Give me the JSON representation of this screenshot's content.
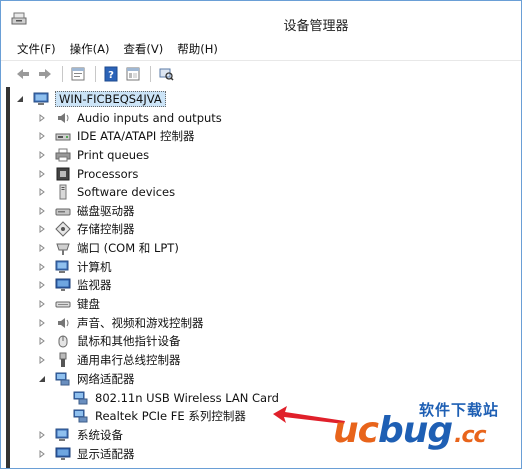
{
  "window": {
    "title": "设备管理器"
  },
  "menu": [
    {
      "label": "文件(F)"
    },
    {
      "label": "操作(A)"
    },
    {
      "label": "查看(V)"
    },
    {
      "label": "帮助(H)"
    }
  ],
  "toolbar": {
    "buttons": [
      {
        "icon": "back-arrow-icon"
      },
      {
        "icon": "forward-arrow-icon"
      },
      {
        "icon": "properties-icon"
      },
      {
        "icon": "help-icon"
      },
      {
        "icon": "console-view-icon"
      },
      {
        "icon": "scan-hardware-icon"
      }
    ]
  },
  "tree": {
    "root": {
      "label": "WIN-FICBEQS4JVA",
      "expanded": true
    },
    "items": [
      {
        "label": "Audio inputs and outputs",
        "icon": "speaker-icon",
        "expanded": false
      },
      {
        "label": "IDE ATA/ATAPI 控制器",
        "icon": "ide-controller-icon",
        "expanded": false
      },
      {
        "label": "Print queues",
        "icon": "printer-icon",
        "expanded": false
      },
      {
        "label": "Processors",
        "icon": "processor-icon",
        "expanded": false
      },
      {
        "label": "Software devices",
        "icon": "software-device-icon",
        "expanded": false
      },
      {
        "label": "磁盘驱动器",
        "icon": "disk-drive-icon",
        "expanded": false
      },
      {
        "label": "存储控制器",
        "icon": "storage-controller-icon",
        "expanded": false
      },
      {
        "label": "端口 (COM 和 LPT)",
        "icon": "port-icon",
        "expanded": false
      },
      {
        "label": "计算机",
        "icon": "computer-icon",
        "expanded": false
      },
      {
        "label": "监视器",
        "icon": "monitor-icon",
        "expanded": false
      },
      {
        "label": "键盘",
        "icon": "keyboard-icon",
        "expanded": false
      },
      {
        "label": "声音、视频和游戏控制器",
        "icon": "sound-controller-icon",
        "expanded": false
      },
      {
        "label": "鼠标和其他指针设备",
        "icon": "mouse-icon",
        "expanded": false
      },
      {
        "label": "通用串行总线控制器",
        "icon": "usb-controller-icon",
        "expanded": false
      },
      {
        "label": "网络适配器",
        "icon": "network-adapter-icon",
        "expanded": true,
        "children": [
          {
            "label": "802.11n USB Wireless LAN Card",
            "icon": "network-adapter-icon"
          },
          {
            "label": "Realtek PCIe FE 系列控制器",
            "icon": "network-adapter-icon"
          }
        ]
      },
      {
        "label": "系统设备",
        "icon": "system-device-icon",
        "expanded": false
      },
      {
        "label": "显示适配器",
        "icon": "display-adapter-icon",
        "expanded": false
      }
    ]
  },
  "watermark": {
    "site_text": "软件下载站",
    "logo_uc": "uc",
    "logo_bug": "bug",
    "logo_cc": ".cc"
  },
  "colors": {
    "accent_orange": "#e8641b",
    "accent_blue": "#1e5fb4",
    "annotation_red": "#e0202a",
    "selection": "#cce4f7"
  }
}
